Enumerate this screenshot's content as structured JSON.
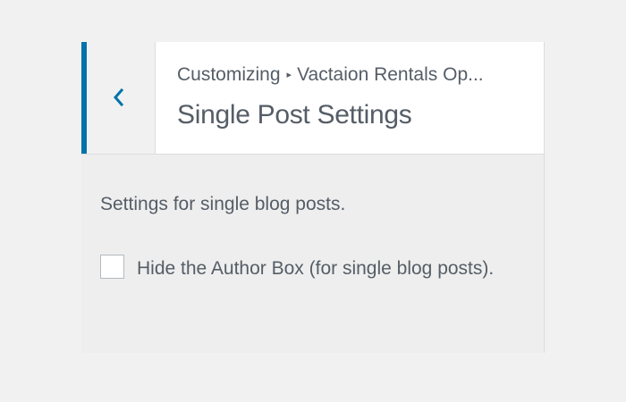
{
  "header": {
    "breadcrumb_root": "Customizing",
    "breadcrumb_separator": "▸",
    "breadcrumb_section": "Vactaion Rentals Op...",
    "title": "Single Post Settings",
    "back_icon": "chevron-left-icon"
  },
  "section": {
    "description": "Settings for single blog posts.",
    "options": [
      {
        "label": "Hide the Author Box (for single blog posts).",
        "checked": false
      }
    ]
  },
  "colors": {
    "accent": "#0073aa",
    "text": "#555d66",
    "panel_bg": "#eeeeee",
    "header_bg": "#ffffff"
  }
}
